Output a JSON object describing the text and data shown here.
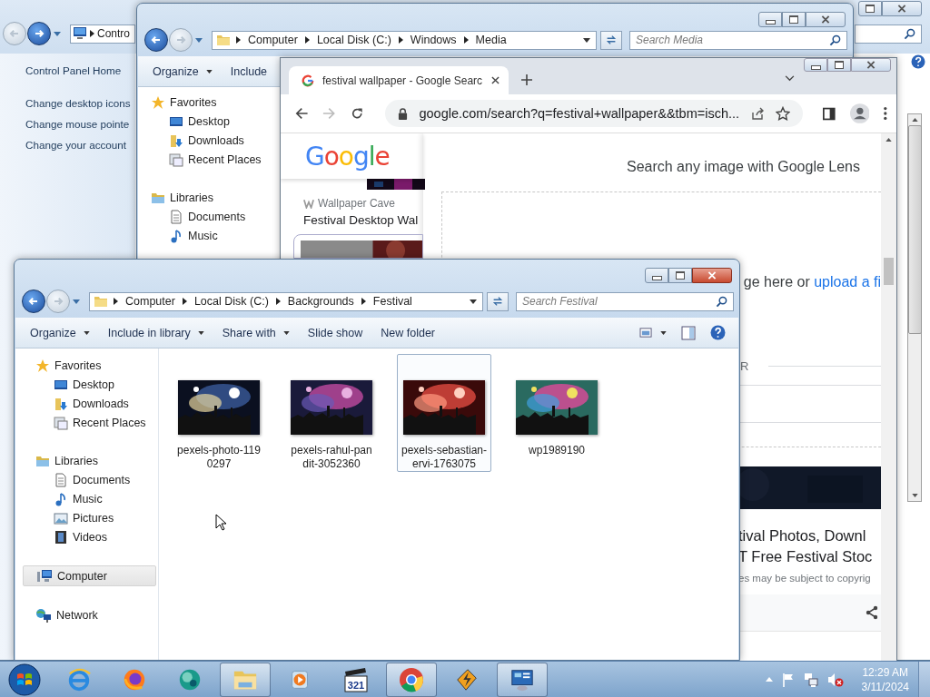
{
  "control_panel": {
    "address": "Contro",
    "back_disabled": true,
    "forward_disabled": false,
    "links": [
      {
        "label": "Control Panel Home"
      },
      {
        "label": "Change desktop icons"
      },
      {
        "label": "Change mouse pointe"
      },
      {
        "label": "Change your account"
      }
    ]
  },
  "media_window": {
    "back_disabled": false,
    "forward_disabled": true,
    "address": [
      "Computer",
      "Local Disk (C:)",
      "Windows",
      "Media"
    ],
    "search_placeholder": "Search Media",
    "toolbar": [
      {
        "label": "Organize",
        "menu": true
      },
      {
        "label": "Include",
        "menu": false
      }
    ],
    "nav": [
      {
        "label": "Favorites",
        "kind": "favorites",
        "children": [
          {
            "label": "Desktop",
            "kind": "desktop"
          },
          {
            "label": "Downloads",
            "kind": "downloads"
          },
          {
            "label": "Recent Places",
            "kind": "recent"
          }
        ]
      },
      {
        "label": "Libraries",
        "kind": "libraries",
        "children": [
          {
            "label": "Documents",
            "kind": "documents"
          },
          {
            "label": "Music",
            "kind": "music"
          }
        ]
      }
    ]
  },
  "chrome": {
    "tab_title": "festival wallpaper - Google Searc",
    "url": "google.com/search?q=festival+wallpaper&&tbm=isch...",
    "logo": "Google",
    "source": "Wallpaper Cave",
    "result_title": "Festival Desktop Wal",
    "lens": {
      "title": "Search any image with Google Lens",
      "drop_text": "ge here or ",
      "upload_link": "upload a fi",
      "divider": "R",
      "result_lines": [
        "tival Photos, Downl",
        "T Free Festival Stoc"
      ],
      "notice": "es may be subject to copyrig"
    }
  },
  "festival_window": {
    "back_disabled": false,
    "forward_disabled": true,
    "address": [
      "Computer",
      "Local Disk (C:)",
      "Backgrounds",
      "Festival"
    ],
    "search_placeholder": "Search Festival",
    "toolbar": [
      {
        "label": "Organize",
        "menu": true
      },
      {
        "label": "Include in library",
        "menu": true
      },
      {
        "label": "Share with",
        "menu": true
      },
      {
        "label": "Slide show",
        "menu": false
      },
      {
        "label": "New folder",
        "menu": false
      }
    ],
    "nav": [
      {
        "label": "Favorites",
        "kind": "favorites",
        "selected": false,
        "children": [
          {
            "label": "Desktop",
            "kind": "desktop",
            "selected": false
          },
          {
            "label": "Downloads",
            "kind": "downloads",
            "selected": false
          },
          {
            "label": "Recent Places",
            "kind": "recent",
            "selected": false
          }
        ]
      },
      {
        "label": "Libraries",
        "kind": "libraries",
        "selected": false,
        "children": [
          {
            "label": "Documents",
            "kind": "documents",
            "selected": false
          },
          {
            "label": "Music",
            "kind": "music",
            "selected": false
          },
          {
            "label": "Pictures",
            "kind": "pictures",
            "selected": false
          },
          {
            "label": "Videos",
            "kind": "videos",
            "selected": false
          }
        ]
      },
      {
        "label": "Computer",
        "kind": "computer",
        "selected": true
      },
      {
        "label": "Network",
        "kind": "network",
        "selected": false
      }
    ],
    "files": [
      {
        "name": "pexels-photo-1190297",
        "selected": false
      },
      {
        "name": "pexels-rahul-pandit-3052360",
        "selected": false
      },
      {
        "name": "pexels-sebastian-ervi-1763075",
        "selected": true
      },
      {
        "name": "wp1989190",
        "selected": false
      }
    ]
  },
  "taskbar": {
    "items": [
      {
        "kind": "start"
      },
      {
        "kind": "ie",
        "running": false
      },
      {
        "kind": "firefox",
        "running": false
      },
      {
        "kind": "teal",
        "running": false
      },
      {
        "kind": "explorer",
        "running": true
      },
      {
        "kind": "media",
        "running": false
      },
      {
        "kind": "mpc",
        "label": "321",
        "running": false
      },
      {
        "kind": "chrome",
        "running": true
      },
      {
        "kind": "winamp",
        "running": false
      },
      {
        "kind": "panel",
        "running": true
      }
    ],
    "tray": [
      {
        "kind": "show-hidden"
      },
      {
        "kind": "flag"
      },
      {
        "kind": "network"
      },
      {
        "kind": "volume",
        "muted": true
      }
    ],
    "time": "12:29 AM",
    "date": "3/11/2024"
  }
}
